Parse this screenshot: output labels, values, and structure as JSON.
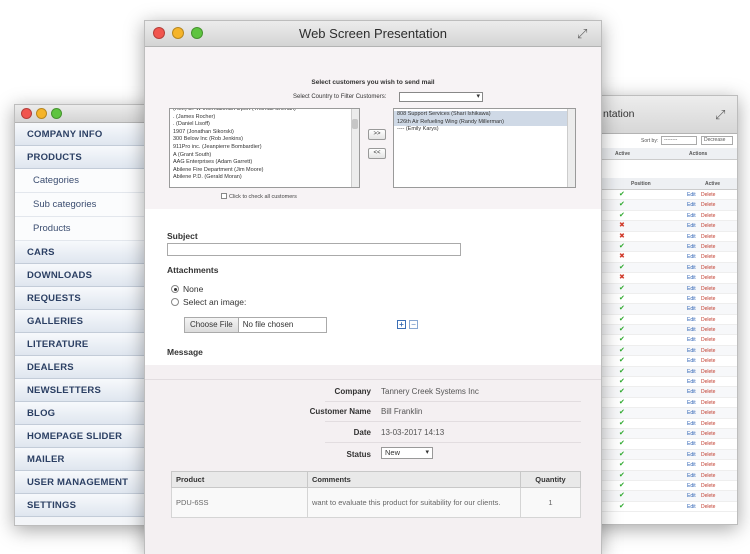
{
  "left_window": {
    "menu": [
      {
        "label": "COMPANY INFO",
        "type": "item",
        "name": "company-info"
      },
      {
        "label": "PRODUCTS",
        "type": "item",
        "name": "products"
      },
      {
        "label": "Categories",
        "type": "sub",
        "name": "categories"
      },
      {
        "label": "Sub categories",
        "type": "sub",
        "name": "sub-categories"
      },
      {
        "label": "Products",
        "type": "sub",
        "name": "products-sub"
      },
      {
        "label": "CARS",
        "type": "item",
        "name": "cars"
      },
      {
        "label": "DOWNLOADS",
        "type": "item",
        "name": "downloads"
      },
      {
        "label": "REQUESTS",
        "type": "item",
        "name": "requests"
      },
      {
        "label": "GALLERIES",
        "type": "item",
        "name": "galleries"
      },
      {
        "label": "LITERATURE",
        "type": "item",
        "name": "literature"
      },
      {
        "label": "DEALERS",
        "type": "item",
        "name": "dealers"
      },
      {
        "label": "NEWSLETTERS",
        "type": "item",
        "name": "newsletters"
      },
      {
        "label": "BLOG",
        "type": "item",
        "name": "blog"
      },
      {
        "label": "HOMEPAGE SLIDER",
        "type": "item",
        "name": "homepage-slider"
      },
      {
        "label": "MAILER",
        "type": "item",
        "name": "mailer"
      },
      {
        "label": "USER MANAGEMENT",
        "type": "item",
        "name": "user-management"
      },
      {
        "label": "SETTINGS",
        "type": "item",
        "name": "settings"
      }
    ]
  },
  "right_window": {
    "title": "ntation",
    "sort_label": "Sort by:",
    "sort_value": "--------",
    "order_value": "Decrease",
    "head_top": {
      "active": "Active",
      "actions": "Actions"
    },
    "head": {
      "position": "Position",
      "active": "Active"
    },
    "edit_label": "Edit",
    "delete_label": "Delete",
    "rows": [
      "ok",
      "ok",
      "ok",
      "no",
      "no",
      "ok",
      "no",
      "ok",
      "no",
      "ok",
      "ok",
      "ok",
      "ok",
      "ok",
      "ok",
      "ok",
      "ok",
      "ok",
      "ok",
      "ok",
      "ok",
      "ok",
      "ok",
      "ok",
      "ok",
      "ok",
      "ok",
      "ok",
      "ok",
      "ok",
      "ok"
    ]
  },
  "main_window": {
    "title": "Web Screen Presentation",
    "select_heading": "Select customers you wish to send mail",
    "country_label": "Select Country to Filter Customers:",
    "left_list": [
      "(Ret.) DPW International Airport (Thomas Shehan)",
      ". (James Rocher)",
      ". (Daniel Lisoff)",
      "1907 (Jonathan Sikorski)",
      "300 Below Inc (Rob Jenkins)",
      "911Pro inc. (Jeanpierre Bombardier)",
      "A (Grant South)",
      "AAG Enterprises (Adam Garrett)",
      "Abilene Fire Department (Jim Moore)",
      "Abilene P.D. (Gerald Moran)"
    ],
    "right_list": [
      "808 Support Services (Shari Ishikawa)",
      "126th Air Refueling Wing (Randy Millerman)",
      "---- (Emily Karys)"
    ],
    "btn_add": ">>",
    "btn_remove": "<<",
    "check_all_label": "Click to check all customers",
    "subject_label": "Subject",
    "attachments_label": "Attachments",
    "radio_none": "None",
    "radio_image": "Select an image:",
    "choose_file": "Choose File",
    "no_file": "No file chosen",
    "message_label": "Message",
    "info": {
      "company_label": "Company",
      "company_value": "Tannery Creek Systems Inc",
      "customer_label": "Customer Name",
      "customer_value": "Bill Franklin",
      "date_label": "Date",
      "date_value": "13-03-2017 14:13",
      "status_label": "Status",
      "status_value": "New"
    },
    "table": {
      "headers": [
        "Product",
        "Comments",
        "Quantity"
      ],
      "rows": [
        {
          "product": "PDU-6SS",
          "comments": "want to evaluate this product for suitability for our clients.",
          "quantity": "1"
        }
      ]
    }
  }
}
